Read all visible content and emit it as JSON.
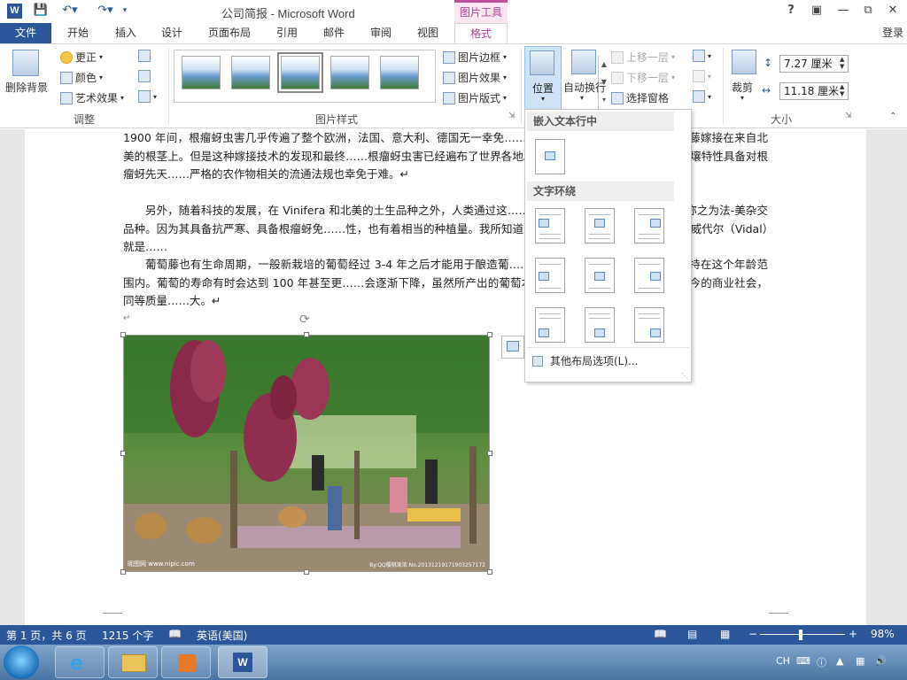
{
  "window": {
    "title": "公司简报 - Microsoft Word",
    "context_tool": "图片工具",
    "help": "?",
    "signin": "登录",
    "logo": "W"
  },
  "tabs": [
    {
      "label": "文件"
    },
    {
      "label": "开始"
    },
    {
      "label": "插入"
    },
    {
      "label": "设计"
    },
    {
      "label": "页面布局"
    },
    {
      "label": "引用"
    },
    {
      "label": "邮件"
    },
    {
      "label": "审阅"
    },
    {
      "label": "视图"
    },
    {
      "label": "格式"
    }
  ],
  "ribbon": {
    "adjust": {
      "remove_bg": "删除背景",
      "corrections": "更正",
      "color": "颜色",
      "artistic": "艺术效果",
      "label": "调整"
    },
    "styles": {
      "label": "图片样式",
      "border": "图片边框",
      "effects": "图片效果",
      "layout": "图片版式"
    },
    "arrange": {
      "position": "位置",
      "wrap": "自动换行",
      "bring_forward": "上移一层",
      "send_backward": "下移一层",
      "selection_pane": "选择窗格"
    },
    "size": {
      "crop": "裁剪",
      "height": "7.27 厘米",
      "width": "11.18 厘米",
      "label": "大小"
    }
  },
  "document": {
    "paragraphs": [
      "1900 年间，根瘤蚜虫害几乎传遍了整个欧洲，法国、意大利、德国无一幸免……解决方案，就是将 Vinifera 葡萄藤嫁接在来自北美的根茎上。但是这种嫁接技术的发现和最终……根瘤蚜虫害已经遍布了世界各地。智利是一个特例，因为智利的土壤特性具备对根瘤蚜先天……严格的农作物相关的流通法规也幸免于难。↵",
      "另外，随着科技的发展，在 Vinifera 和北美的土生品种之外，人类通过这……可以用以酿造葡酒的葡萄品种，称之为法-美杂交品种。因为其具备抗严寒、具备根瘤蚜免……性，也有着相当的种植量。我所知道的在加拿大常用于冰酒酿造的葡萄威代尔（Vidal）就是……",
      "葡萄藤也有生命周期，一般新栽培的葡萄经过 3-4 年之后才能用于酿造葡……多数葡萄园会将所种植的葡萄保持在这个年龄范围内。葡萄的寿命有时会达到 100 年甚至更……会逐渐下降，虽然所产出的葡萄本身的质量还是很高，但毕竟在如今的商业社会，同等质量……大。↵"
    ],
    "empty_mark": "↵",
    "photo_watermark_left": "昵图网 www.nipic.com",
    "photo_watermark_right": "By:QQ樱桃渐浓 No.20131219171903257172"
  },
  "dropdown": {
    "inline_header": "嵌入文本行中",
    "wrap_header": "文字环绕",
    "more_options": "其他布局选项(L)..."
  },
  "status": {
    "page": "第 1 页，共 6 页",
    "words": "1215 个字",
    "language": "英语(美国)",
    "zoom": "98%",
    "zoom_minus": "−",
    "zoom_plus": "+"
  },
  "taskbar": {
    "lang": "CH"
  }
}
